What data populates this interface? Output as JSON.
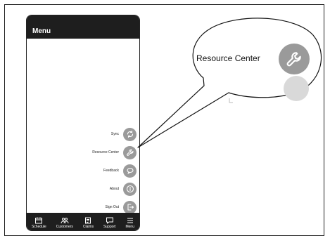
{
  "phone": {
    "header_title": "Menu",
    "menu_items": [
      {
        "label": "Sync",
        "icon": "sync-icon"
      },
      {
        "label": "Resource Center",
        "icon": "wrench-icon"
      },
      {
        "label": "Feedback",
        "icon": "speech-bubble-icon"
      },
      {
        "label": "About",
        "icon": "info-icon"
      },
      {
        "label": "Sign Out",
        "icon": "sign-out-icon"
      }
    ],
    "tabs": [
      {
        "label": "Schedule",
        "icon": "calendar-icon"
      },
      {
        "label": "Customers",
        "icon": "people-icon"
      },
      {
        "label": "Claims",
        "icon": "clipboard-icon"
      },
      {
        "label": "Support",
        "icon": "chat-icon"
      },
      {
        "label": "Menu",
        "icon": "hamburger-icon"
      }
    ]
  },
  "callout": {
    "label": "Resource Center",
    "icon": "wrench-icon"
  },
  "colors": {
    "header_bg": "#1e1e1e",
    "icon_bg": "#9a9a9a",
    "icon_fg": "#ffffff"
  }
}
